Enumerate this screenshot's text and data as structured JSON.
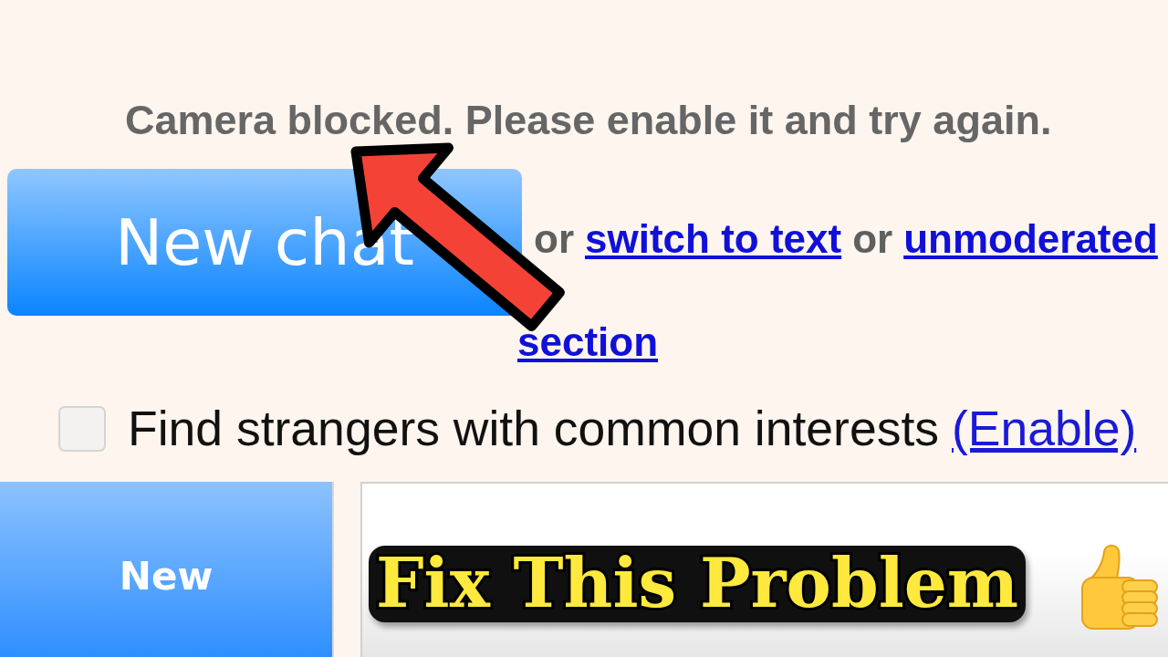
{
  "status_message": {
    "text": "Camera blocked. Please enable it and try again."
  },
  "new_chat_button": {
    "label": "New chat"
  },
  "alternatives": [
    {
      "kind": "text",
      "text": "or"
    },
    {
      "kind": "link",
      "text": "switch to text"
    },
    {
      "kind": "text",
      "text": "or"
    },
    {
      "kind": "link",
      "text": "unmoderated"
    },
    {
      "kind": "link",
      "text": "section"
    }
  ],
  "interests": {
    "checked": false,
    "label": "Find strangers with common interests",
    "link": "(Enable)"
  },
  "chat_bar": {
    "new_button": {
      "label": "New"
    }
  },
  "overlay_caption": {
    "text": "Fix This Problem"
  }
}
